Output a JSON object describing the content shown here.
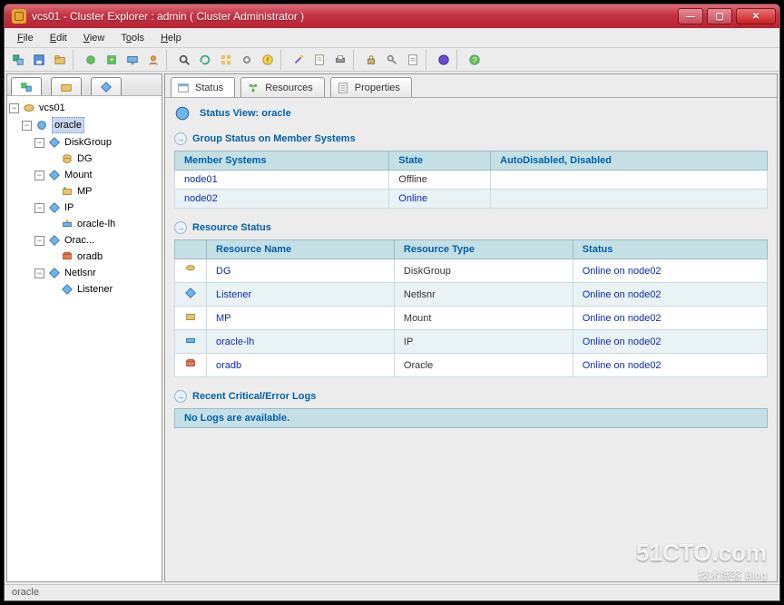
{
  "title": "vcs01 - Cluster Explorer : admin ( Cluster Administrator )",
  "menus": [
    "File",
    "Edit",
    "View",
    "Tools",
    "Help"
  ],
  "tree": {
    "root": "vcs01",
    "group": "oracle",
    "nodes": [
      {
        "name": "DiskGroup",
        "child": "DG"
      },
      {
        "name": "Mount",
        "child": "MP"
      },
      {
        "name": "IP",
        "child": "oracle-lh"
      },
      {
        "name": "Orac...",
        "child": "oradb"
      },
      {
        "name": "Netlsnr",
        "child": "Listener"
      }
    ]
  },
  "tabs": {
    "status": "Status",
    "resources": "Resources",
    "properties": "Properties"
  },
  "status_view": {
    "label": "Status View:",
    "target": "oracle"
  },
  "group_status": {
    "title": "Group Status on Member Systems",
    "headers": [
      "Member Systems",
      "State",
      "AutoDisabled, Disabled"
    ],
    "rows": [
      {
        "member": "node01",
        "state": "Offline",
        "auto": ""
      },
      {
        "member": "node02",
        "state": "Online",
        "auto": ""
      }
    ]
  },
  "resource_status": {
    "title": "Resource Status",
    "headers": [
      "Resource Name",
      "Resource Type",
      "Status"
    ],
    "rows": [
      {
        "name": "DG",
        "type": "DiskGroup",
        "status": "Online on node02"
      },
      {
        "name": "Listener",
        "type": "Netlsnr",
        "status": "Online on node02"
      },
      {
        "name": "MP",
        "type": "Mount",
        "status": "Online on node02"
      },
      {
        "name": "oracle-lh",
        "type": "IP",
        "status": "Online on node02"
      },
      {
        "name": "oradb",
        "type": "Oracle",
        "status": "Online on node02"
      }
    ]
  },
  "logs": {
    "title": "Recent Critical/Error Logs",
    "empty": "No Logs are available."
  },
  "statusbar": "oracle",
  "watermark": {
    "big": "51CTO.com",
    "small": "技术博客  Blog"
  }
}
